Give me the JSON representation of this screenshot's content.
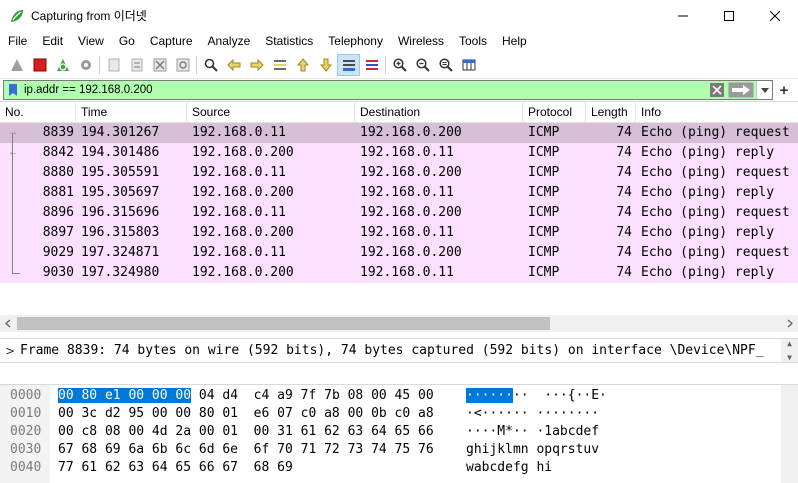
{
  "window": {
    "title": "Capturing from 이더넷"
  },
  "menu": [
    "File",
    "Edit",
    "View",
    "Go",
    "Capture",
    "Analyze",
    "Statistics",
    "Telephony",
    "Wireless",
    "Tools",
    "Help"
  ],
  "filter": {
    "value": "ip.addr == 192.168.0.200",
    "bg_color": "#afffaf"
  },
  "packet_list": {
    "columns": [
      "No.",
      "Time",
      "Source",
      "Destination",
      "Protocol",
      "Length",
      "Info"
    ],
    "rows": [
      {
        "no": "8839",
        "time": "194.301267",
        "src": "192.168.0.11",
        "dst": "192.168.0.200",
        "proto": "ICMP",
        "len": "74",
        "info": "Echo (ping) request"
      },
      {
        "no": "8842",
        "time": "194.301486",
        "src": "192.168.0.200",
        "dst": "192.168.0.11",
        "proto": "ICMP",
        "len": "74",
        "info": "Echo (ping) reply"
      },
      {
        "no": "8880",
        "time": "195.305591",
        "src": "192.168.0.11",
        "dst": "192.168.0.200",
        "proto": "ICMP",
        "len": "74",
        "info": "Echo (ping) request"
      },
      {
        "no": "8881",
        "time": "195.305697",
        "src": "192.168.0.200",
        "dst": "192.168.0.11",
        "proto": "ICMP",
        "len": "74",
        "info": "Echo (ping) reply"
      },
      {
        "no": "8896",
        "time": "196.315696",
        "src": "192.168.0.11",
        "dst": "192.168.0.200",
        "proto": "ICMP",
        "len": "74",
        "info": "Echo (ping) request"
      },
      {
        "no": "8897",
        "time": "196.315803",
        "src": "192.168.0.200",
        "dst": "192.168.0.11",
        "proto": "ICMP",
        "len": "74",
        "info": "Echo (ping) reply"
      },
      {
        "no": "9029",
        "time": "197.324871",
        "src": "192.168.0.11",
        "dst": "192.168.0.200",
        "proto": "ICMP",
        "len": "74",
        "info": "Echo (ping) request"
      },
      {
        "no": "9030",
        "time": "197.324980",
        "src": "192.168.0.200",
        "dst": "192.168.0.11",
        "proto": "ICMP",
        "len": "74",
        "info": "Echo (ping) reply"
      }
    ],
    "selected_index": 0,
    "row_color": "#fce0ff",
    "selected_color": "#d6bfd7"
  },
  "detail": {
    "text": "Frame 8839: 74 bytes on wire (592 bits), 74 bytes captured (592 bits) on interface \\Device\\NPF_"
  },
  "bytes": {
    "rows": [
      {
        "offset": "0000",
        "hex_hl": "00 80 e1 00 00 00",
        "hex": " 04 d4  c4 a9 7f 7b 08 00 45 00",
        "ascii_hl": "······",
        "ascii": "··  ···{··E·"
      },
      {
        "offset": "0010",
        "hex_hl": "",
        "hex": "00 3c d2 95 00 00 80 01  e6 07 c0 a8 00 0b c0 a8",
        "ascii_hl": "",
        "ascii": "·<······ ········"
      },
      {
        "offset": "0020",
        "hex_hl": "",
        "hex": "00 c8 08 00 4d 2a 00 01  00 31 61 62 63 64 65 66",
        "ascii_hl": "",
        "ascii": "····M*·· ·1abcdef"
      },
      {
        "offset": "0030",
        "hex_hl": "",
        "hex": "67 68 69 6a 6b 6c 6d 6e  6f 70 71 72 73 74 75 76",
        "ascii_hl": "",
        "ascii": "ghijklmn opqrstuv"
      },
      {
        "offset": "0040",
        "hex_hl": "",
        "hex": "77 61 62 63 64 65 66 67  68 69",
        "ascii_hl": "",
        "ascii": "wabcdefg hi"
      }
    ]
  }
}
